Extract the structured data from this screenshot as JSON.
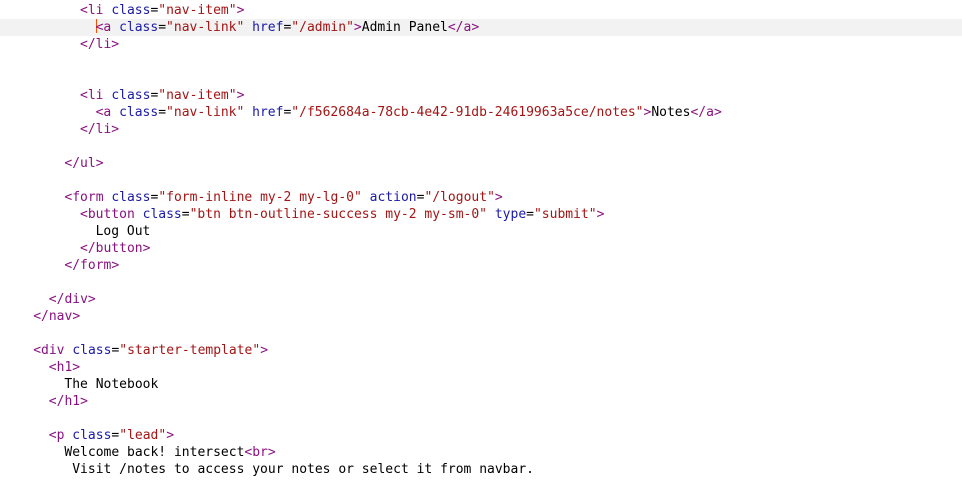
{
  "colors": {
    "tag": "#881280",
    "attr_name": "#1a1aa6",
    "attr_value": "#a31515",
    "text": "#000000",
    "current_line_bg": "#f2f2f2",
    "caret": "#ff4d00"
  },
  "lines": [
    {
      "indent": 5,
      "current": false,
      "tokens": [
        {
          "t": "tag",
          "v": "<li"
        },
        {
          "t": "text",
          "v": " "
        },
        {
          "t": "attr_name",
          "v": "class"
        },
        {
          "t": "text",
          "v": "="
        },
        {
          "t": "attr_value",
          "v": "\"nav-item\""
        },
        {
          "t": "tag",
          "v": ">"
        }
      ]
    },
    {
      "indent": 6,
      "current": true,
      "caret": true,
      "tokens": [
        {
          "t": "tag",
          "v": "<a"
        },
        {
          "t": "text",
          "v": " "
        },
        {
          "t": "attr_name",
          "v": "class"
        },
        {
          "t": "text",
          "v": "="
        },
        {
          "t": "attr_value",
          "v": "\"nav-link\""
        },
        {
          "t": "text",
          "v": " "
        },
        {
          "t": "attr_name",
          "v": "href"
        },
        {
          "t": "text",
          "v": "="
        },
        {
          "t": "attr_value",
          "v": "\"/admin\""
        },
        {
          "t": "tag",
          "v": ">"
        },
        {
          "t": "text",
          "v": "Admin Panel"
        },
        {
          "t": "tag",
          "v": "</a>"
        }
      ]
    },
    {
      "indent": 5,
      "current": false,
      "tokens": [
        {
          "t": "tag",
          "v": "</li>"
        }
      ]
    },
    {
      "indent": 0,
      "current": false,
      "tokens": []
    },
    {
      "indent": 0,
      "current": false,
      "tokens": []
    },
    {
      "indent": 5,
      "current": false,
      "tokens": [
        {
          "t": "tag",
          "v": "<li"
        },
        {
          "t": "text",
          "v": " "
        },
        {
          "t": "attr_name",
          "v": "class"
        },
        {
          "t": "text",
          "v": "="
        },
        {
          "t": "attr_value",
          "v": "\"nav-item\""
        },
        {
          "t": "tag",
          "v": ">"
        }
      ]
    },
    {
      "indent": 6,
      "current": false,
      "tokens": [
        {
          "t": "tag",
          "v": "<a"
        },
        {
          "t": "text",
          "v": " "
        },
        {
          "t": "attr_name",
          "v": "class"
        },
        {
          "t": "text",
          "v": "="
        },
        {
          "t": "attr_value",
          "v": "\"nav-link\""
        },
        {
          "t": "text",
          "v": " "
        },
        {
          "t": "attr_name",
          "v": "href"
        },
        {
          "t": "text",
          "v": "="
        },
        {
          "t": "attr_value",
          "v": "\"/f562684a-78cb-4e42-91db-24619963a5ce/notes\""
        },
        {
          "t": "tag",
          "v": ">"
        },
        {
          "t": "text",
          "v": "Notes"
        },
        {
          "t": "tag",
          "v": "</a>"
        }
      ]
    },
    {
      "indent": 5,
      "current": false,
      "tokens": [
        {
          "t": "tag",
          "v": "</li>"
        }
      ]
    },
    {
      "indent": 0,
      "current": false,
      "tokens": []
    },
    {
      "indent": 4,
      "current": false,
      "tokens": [
        {
          "t": "tag",
          "v": "</ul>"
        }
      ]
    },
    {
      "indent": 0,
      "current": false,
      "tokens": []
    },
    {
      "indent": 4,
      "current": false,
      "tokens": [
        {
          "t": "tag",
          "v": "<form"
        },
        {
          "t": "text",
          "v": " "
        },
        {
          "t": "attr_name",
          "v": "class"
        },
        {
          "t": "text",
          "v": "="
        },
        {
          "t": "attr_value",
          "v": "\"form-inline my-2 my-lg-0\""
        },
        {
          "t": "text",
          "v": " "
        },
        {
          "t": "attr_name",
          "v": "action"
        },
        {
          "t": "text",
          "v": "="
        },
        {
          "t": "attr_value",
          "v": "\"/logout\""
        },
        {
          "t": "tag",
          "v": ">"
        }
      ]
    },
    {
      "indent": 5,
      "current": false,
      "tokens": [
        {
          "t": "tag",
          "v": "<button"
        },
        {
          "t": "text",
          "v": " "
        },
        {
          "t": "attr_name",
          "v": "class"
        },
        {
          "t": "text",
          "v": "="
        },
        {
          "t": "attr_value",
          "v": "\"btn btn-outline-success my-2 my-sm-0\""
        },
        {
          "t": "text",
          "v": " "
        },
        {
          "t": "attr_name",
          "v": "type"
        },
        {
          "t": "text",
          "v": "="
        },
        {
          "t": "attr_value",
          "v": "\"submit\""
        },
        {
          "t": "tag",
          "v": ">"
        }
      ]
    },
    {
      "indent": 6,
      "current": false,
      "tokens": [
        {
          "t": "text",
          "v": "Log Out"
        }
      ]
    },
    {
      "indent": 5,
      "current": false,
      "tokens": [
        {
          "t": "tag",
          "v": "</button>"
        }
      ]
    },
    {
      "indent": 4,
      "current": false,
      "tokens": [
        {
          "t": "tag",
          "v": "</form>"
        }
      ]
    },
    {
      "indent": 0,
      "current": false,
      "tokens": []
    },
    {
      "indent": 3,
      "current": false,
      "tokens": [
        {
          "t": "tag",
          "v": "</div>"
        }
      ]
    },
    {
      "indent": 2,
      "current": false,
      "tokens": [
        {
          "t": "tag",
          "v": "</nav>"
        }
      ]
    },
    {
      "indent": 0,
      "current": false,
      "tokens": []
    },
    {
      "indent": 2,
      "current": false,
      "tokens": [
        {
          "t": "tag",
          "v": "<div"
        },
        {
          "t": "text",
          "v": " "
        },
        {
          "t": "attr_name",
          "v": "class"
        },
        {
          "t": "text",
          "v": "="
        },
        {
          "t": "attr_value",
          "v": "\"starter-template\""
        },
        {
          "t": "tag",
          "v": ">"
        }
      ]
    },
    {
      "indent": 3,
      "current": false,
      "tokens": [
        {
          "t": "tag",
          "v": "<h1>"
        }
      ]
    },
    {
      "indent": 4,
      "current": false,
      "tokens": [
        {
          "t": "text",
          "v": "The Notebook"
        }
      ]
    },
    {
      "indent": 3,
      "current": false,
      "tokens": [
        {
          "t": "tag",
          "v": "</h1>"
        }
      ]
    },
    {
      "indent": 0,
      "current": false,
      "tokens": []
    },
    {
      "indent": 3,
      "current": false,
      "tokens": [
        {
          "t": "tag",
          "v": "<p"
        },
        {
          "t": "text",
          "v": " "
        },
        {
          "t": "attr_name",
          "v": "class"
        },
        {
          "t": "text",
          "v": "="
        },
        {
          "t": "attr_value",
          "v": "\"lead\""
        },
        {
          "t": "tag",
          "v": ">"
        }
      ]
    },
    {
      "indent": 4,
      "current": false,
      "tokens": [
        {
          "t": "text",
          "v": "Welcome back! intersect"
        },
        {
          "t": "tag",
          "v": "<br>"
        }
      ]
    },
    {
      "indent": 4,
      "current": false,
      "lead": " ",
      "tokens": [
        {
          "t": "text",
          "v": "Visit /notes to access your notes or select it from navbar."
        }
      ]
    }
  ]
}
